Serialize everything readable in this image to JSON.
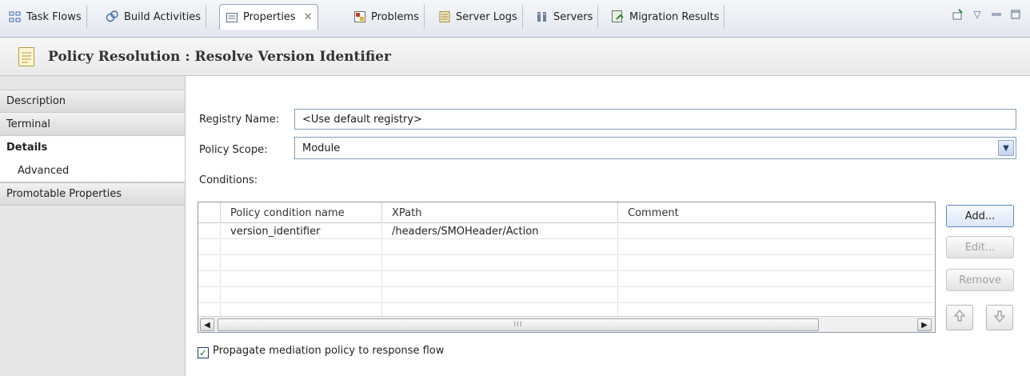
{
  "tabs": [
    {
      "label": "Task Flows",
      "icon": "task-flows-icon"
    },
    {
      "label": "Build Activities",
      "icon": "build-activities-icon"
    },
    {
      "label": "Properties",
      "icon": "properties-icon",
      "active": true
    },
    {
      "label": "Problems",
      "icon": "problems-icon"
    },
    {
      "label": "Server Logs",
      "icon": "server-logs-icon"
    },
    {
      "label": "Servers",
      "icon": "servers-icon"
    },
    {
      "label": "Migration Results",
      "icon": "migration-results-icon"
    }
  ],
  "header": {
    "title": "Policy Resolution : Resolve Version Identifier",
    "icon": "document-icon"
  },
  "nav": {
    "items": [
      {
        "label": "Description"
      },
      {
        "label": "Terminal"
      },
      {
        "label": "Details",
        "selected": true
      },
      {
        "label": "Advanced"
      },
      {
        "label": "Promotable Properties"
      }
    ]
  },
  "form": {
    "registry_name_label": "Registry Name:",
    "registry_name_value": "<Use default registry>",
    "policy_scope_label": "Policy Scope:",
    "policy_scope_value": "Module",
    "conditions_label": "Conditions:"
  },
  "table": {
    "columns": [
      "Policy condition name",
      "XPath",
      "Comment"
    ],
    "rows": [
      {
        "name": "version_identifier",
        "xpath": "/headers/SMOHeader/Action",
        "comment": ""
      }
    ],
    "scroll_grip": "III"
  },
  "buttons": {
    "add": "Add...",
    "edit": "Edit...",
    "remove": "Remove",
    "move_up_icon": "move-up-icon",
    "move_down_icon": "move-down-icon"
  },
  "propagate": {
    "label": "Propagate mediation policy to response flow",
    "checked": true
  },
  "colors": {
    "accent": "#5b86c4",
    "check": "#1a8a1a",
    "nav_bg": "#e5e5e5"
  }
}
